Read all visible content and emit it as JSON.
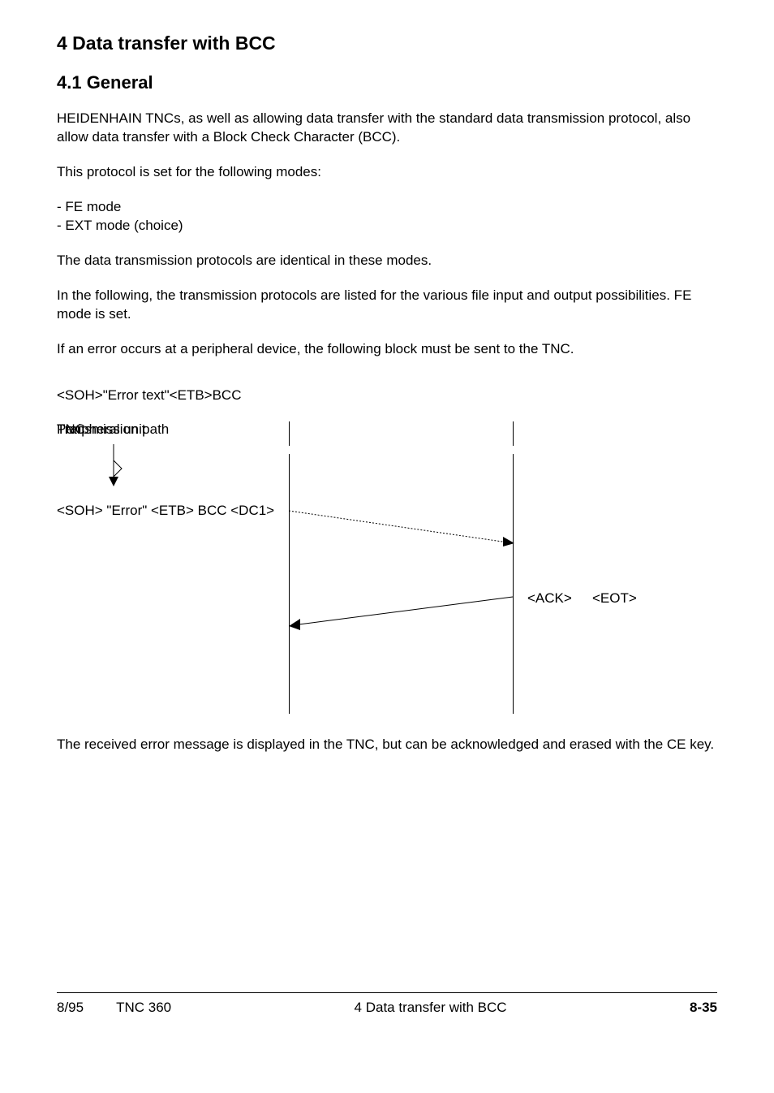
{
  "headings": {
    "h1": "4   Data transfer with BCC",
    "h2": "4.1  General"
  },
  "paragraphs": {
    "p1": "HEIDENHAIN TNCs, as well as allowing data transfer with the standard data transmission protocol, also allow data transfer with a Block Check Character (BCC).",
    "p2": "This protocol is set for the following modes:",
    "li1": "- FE mode",
    "li2": "- EXT mode (choice)",
    "p3": "The data transmission protocols are identical in these modes.",
    "p4": "In the following, the transmission protocols are listed for the various file input and output possibilities. FE mode is set.",
    "p5": "If an error occurs at a peripheral device, the following block must be sent to the TNC.",
    "codeline": "<SOH>\"Error text\"<ETB>BCC",
    "p6": "The received error message is displayed in the TNC, but can be acknowledged and erased with the CE key."
  },
  "diagram": {
    "col1": "Peripheral unit",
    "col2": "Transmission path",
    "col3": "TNC",
    "msg1": "<SOH> \"Error\" <ETB> BCC <DC1>",
    "msg2a": "<ACK>",
    "msg2b": "<EOT>"
  },
  "footer": {
    "date": "8/95",
    "model": "TNC 360",
    "section": "4   Data transfer with BCC",
    "pagenum": "8-35"
  }
}
